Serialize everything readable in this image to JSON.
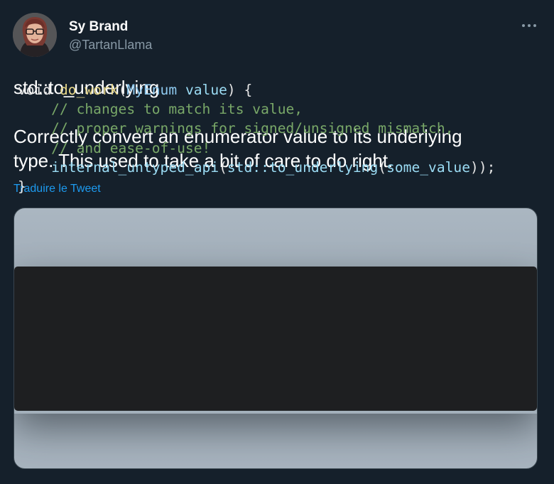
{
  "author": {
    "name": "Sy Brand",
    "handle": "@TartanLlama",
    "avatar_icon": "profile-photo"
  },
  "more_icon": "more-horizontal-icon",
  "tweet": {
    "title_line": "std::to_underlying",
    "body_line_1": "Correctly convert an enumerator value to its underlying",
    "body_line_2": "type. This used to take a bit of care to do right.",
    "translate_label": "Traduire le Tweet"
  },
  "code": {
    "line1": {
      "kw": "void ",
      "fn": "do_work",
      "open": "(",
      "type": "MyEnum",
      "space": " ",
      "param": "value",
      "close": ") {"
    },
    "line2": "    // changes to match its value,",
    "line3": "    // proper warnings for signed/unsigned mismatch,",
    "line4": "    // and ease-of-use!",
    "line5": {
      "indent": "    ",
      "fn": "internal_untyped_api",
      "open": "(",
      "ns_fn": "std::to_underlying",
      "open2": "(",
      "arg": "some_value",
      "close": "));"
    },
    "line6": "}"
  },
  "colors": {
    "background": "#15202b",
    "link": "#1d9bf0",
    "handle": "#8899a6",
    "code_bg": "#1e1f21",
    "comment": "#79a868",
    "function": "#e8d88a",
    "type": "#8fcaf0"
  }
}
